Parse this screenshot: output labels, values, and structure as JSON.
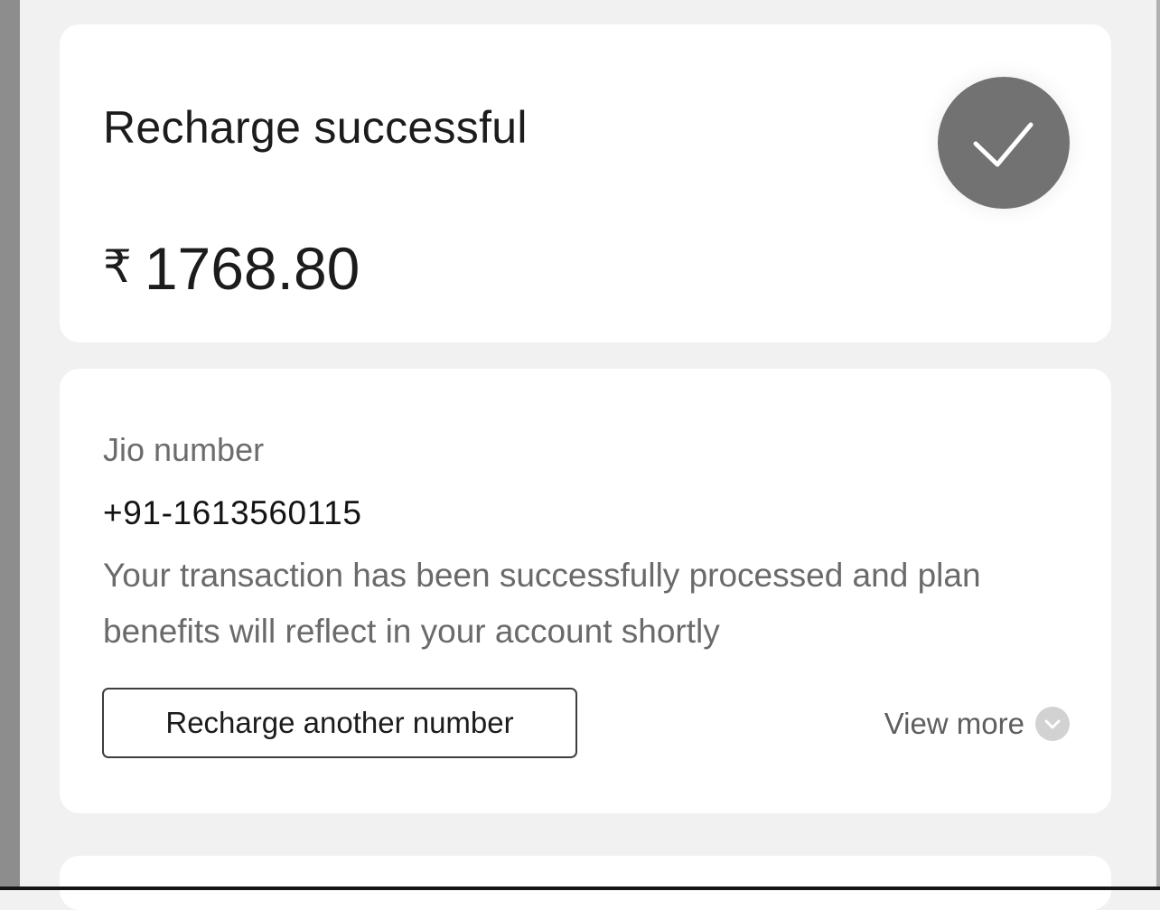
{
  "status_card": {
    "title": "Recharge successful",
    "currency_symbol": "₹",
    "amount": "1768.80",
    "icon": "check-circle-icon"
  },
  "details_card": {
    "label": "Jio number",
    "number": "+91-1613560115",
    "message": "Your transaction has been successfully processed and plan benefits will reflect in your account shortly",
    "recharge_another_label": "Recharge another number",
    "view_more_label": "View more",
    "view_more_icon": "chevron-down-icon"
  },
  "colors": {
    "page_background": "#f1f1f1",
    "card_background": "#ffffff",
    "success_badge": "#727272",
    "primary_text": "#1c1c1c",
    "secondary_text": "#6a6a6a"
  }
}
